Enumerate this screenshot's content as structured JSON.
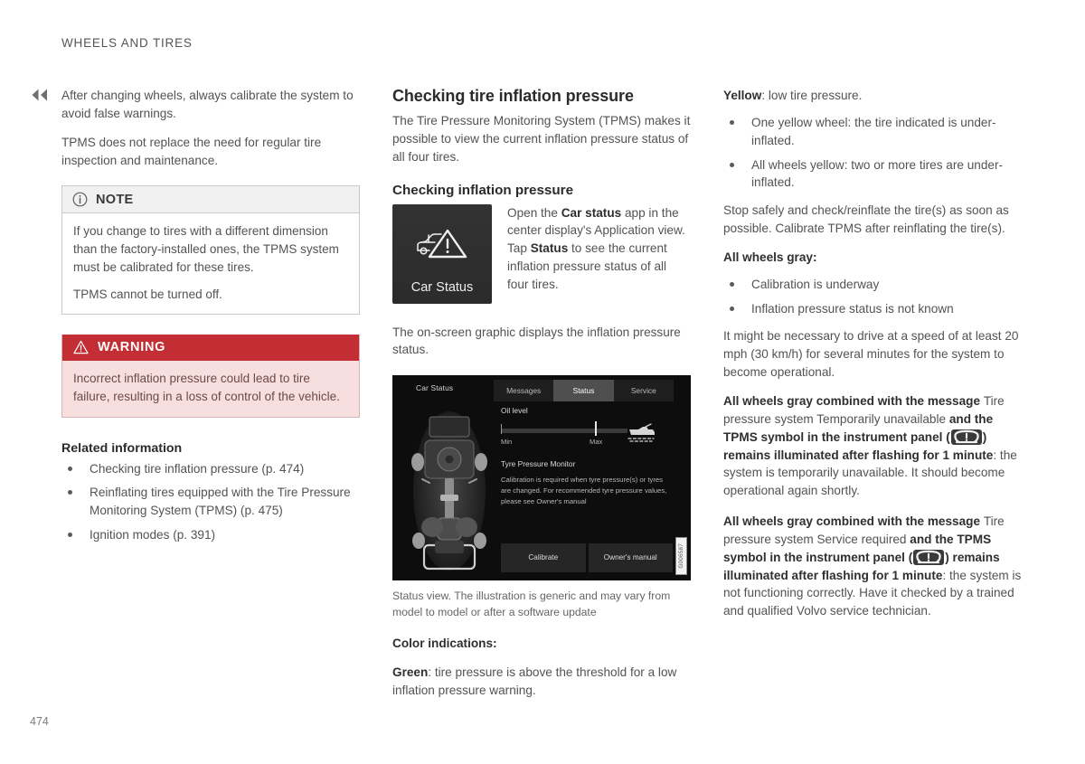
{
  "page": {
    "running_header": "WHEELS AND TIRES",
    "folio": "474",
    "continuation_icon": "double-chevron-left-icon"
  },
  "column_left": {
    "paragraphs": [
      "After changing wheels, always calibrate the system to avoid false warnings.",
      "TPMS does not replace the need for regular tire inspection and maintenance."
    ],
    "note": {
      "icon": "info-circle-icon",
      "label": "NOTE",
      "paragraphs": [
        "If you change to tires with a different dimension than the factory-installed ones, the TPMS system must be calibrated for these tires.",
        "TPMS cannot be turned off."
      ]
    },
    "warning": {
      "icon": "warning-triangle-icon",
      "label": "WARNING",
      "text": "Incorrect inflation pressure could lead to tire failure, resulting in a loss of control of the vehicle.",
      "header_color": "#c32e34",
      "body_color": "#f7dfdf"
    },
    "related": {
      "title": "Related information",
      "items": [
        "Checking tire inflation pressure (p. 474)",
        "Reinflating tires equipped with the Tire Pressure Monitoring System (TPMS) (p. 475)",
        "Ignition modes (p. 391)"
      ]
    }
  },
  "column_center": {
    "section_title": "Checking tire inflation pressure",
    "intro": "The Tire Pressure Monitoring System (TPMS) makes it possible to view the current inflation pressure status of all four tires.",
    "sub_title": "Checking inflation pressure",
    "app_tile": {
      "label": "Car Status",
      "icon": "car-warning-triangle-icon"
    },
    "app_instruction": {
      "part1": "Open the ",
      "bold1": "Car status",
      "part2": " app in the center display's Application view. Tap ",
      "bold2": "Status",
      "part3": " to see the current inflation pressure status of all four tires."
    },
    "graphic_intro": "The on-screen graphic displays the inflation pressure status.",
    "screenshot": {
      "title": "Car Status",
      "tabs": [
        {
          "label": "Messages",
          "active": false
        },
        {
          "label": "Status",
          "active": true
        },
        {
          "label": "Service",
          "active": false
        }
      ],
      "oil_level_heading": "Oil level",
      "oil_min_label": "Min",
      "oil_max_label": "Max",
      "oil_icon": "oil-can-icon",
      "tpm_heading": "Tyre Pressure Monitor",
      "tpm_body": "Calibration is required when tyre pressure(s) or tyres are changed. For recommended tyre pressure values, please see Owner's manual",
      "buttons": [
        "Calibrate",
        "Owner's manual"
      ],
      "figure_id": "G006587"
    },
    "caption": "Status view. The illustration is generic and may vary from model to model or after a software update",
    "color_indications_title": "Color indications:",
    "green": {
      "bold": "Green",
      "rest": ": tire pressure is above the threshold for a low inflation pressure warning."
    }
  },
  "column_right": {
    "yellow": {
      "bold": "Yellow",
      "rest": ": low tire pressure."
    },
    "yellow_bullets": [
      "One yellow wheel: the tire indicated is under-inflated.",
      "All wheels yellow: two or more tires are under-inflated."
    ],
    "yellow_note": "Stop safely and check/reinflate the tire(s) as soon as possible. Calibrate TPMS after reinflating the tire(s).",
    "gray_title": "All wheels gray:",
    "gray_bullets": [
      "Calibration is underway",
      "Inflation pressure status is not known"
    ],
    "gray_note": "It might be necessary to drive at a speed of at least 20 mph (30 km/h) for several minutes for the system to become operational.",
    "temporarily": {
      "b1": "All wheels gray combined with the message ",
      "n1": "Tire pressure system Temporarily unavailable",
      "b2": " and the TPMS symbol in the instrument panel (",
      "symbol": "tpms-warning-icon",
      "b3": ") remains illuminated after flashing for 1 minute",
      "n2": ": the system is temporarily unavailable. It should become operational again shortly."
    },
    "service": {
      "b1": "All wheels gray combined with the message ",
      "n1": "Tire pressure system Service required",
      "b2": " and the TPMS symbol in the instrument panel (",
      "symbol": "tpms-warning-icon",
      "b3": ") remains illuminated after flashing for 1 minute",
      "n2": ": the system is not functioning correctly. Have it checked by a trained and qualified Volvo service technician."
    }
  }
}
